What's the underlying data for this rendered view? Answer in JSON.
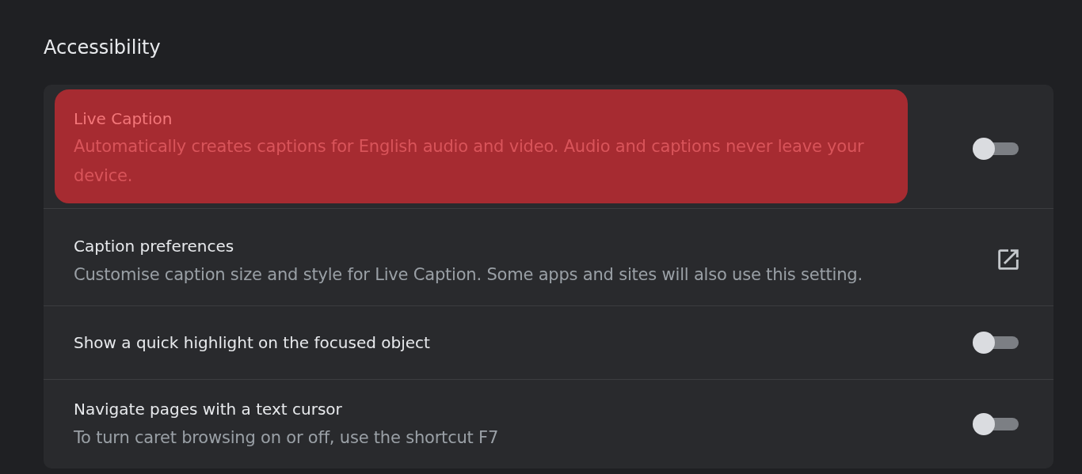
{
  "section_title": "Accessibility",
  "rows": [
    {
      "kind": "toggle",
      "label": "Live Caption",
      "description": "Automatically creates captions for English audio and video. Audio and captions never leave your device.",
      "on": false,
      "highlighted": true
    },
    {
      "kind": "link",
      "label": "Caption preferences",
      "description": "Customise caption size and style for Live Caption. Some apps and sites will also use this setting.",
      "highlighted": false
    },
    {
      "kind": "toggle",
      "label": "Show a quick highlight on the focused object",
      "on": false,
      "highlighted": false
    },
    {
      "kind": "toggle",
      "label": "Navigate pages with a text cursor",
      "description": "To turn caret browsing on or off, use the shortcut F7",
      "on": false,
      "highlighted": false
    }
  ]
}
